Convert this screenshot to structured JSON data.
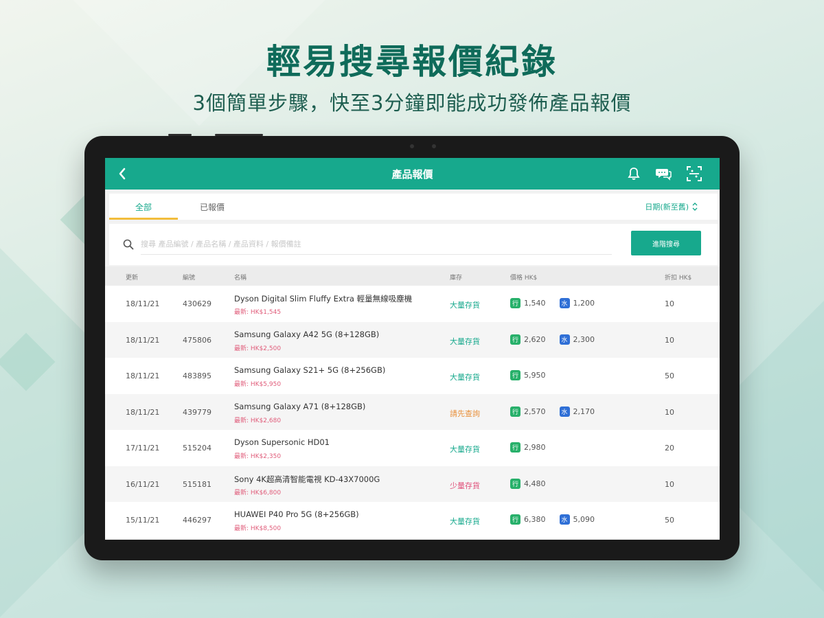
{
  "promo": {
    "title": "輕易搜尋報價紀錄",
    "subtitle": "3個簡單步驟，快至3分鐘即能成功發佈產品報價"
  },
  "app": {
    "title": "產品報價",
    "icons": [
      "back-chevron-icon",
      "bell-icon",
      "chat-icon",
      "scan-icon"
    ],
    "accent_color": "#17a98d"
  },
  "tabs": {
    "all": "全部",
    "quoted": "已報價",
    "sort_label": "日期(新至舊)"
  },
  "search": {
    "placeholder": "搜尋 產品編號 / 產品名稱 / 產品資料 / 報價備註",
    "advanced_button": "進階搜尋"
  },
  "table": {
    "headers": {
      "updated": "更新",
      "code": "編號",
      "name": "名稱",
      "stock": "庫存",
      "price": "價格 HK$",
      "discount": "折扣 HK$"
    },
    "rows": [
      {
        "date": "18/11/21",
        "code": "430629",
        "name": "Dyson Digital Slim Fluffy Extra 輕量無線吸塵機",
        "ref": "最新: HK$1,545",
        "stock": "大量存貨",
        "stock_color": "green",
        "price_a": "1,540",
        "price_b": "1,200",
        "discount": "10"
      },
      {
        "date": "18/11/21",
        "code": "475806",
        "name": "Samsung Galaxy A42 5G (8+128GB)",
        "ref": "最新: HK$2,500",
        "stock": "大量存貨",
        "stock_color": "green",
        "price_a": "2,620",
        "price_b": "2,300",
        "discount": "10"
      },
      {
        "date": "18/11/21",
        "code": "483895",
        "name": "Samsung Galaxy S21+ 5G (8+256GB)",
        "ref": "最新: HK$5,950",
        "stock": "大量存貨",
        "stock_color": "green",
        "price_a": "5,950",
        "price_b": "",
        "discount": "50"
      },
      {
        "date": "18/11/21",
        "code": "439779",
        "name": "Samsung Galaxy A71 (8+128GB)",
        "ref": "最新: HK$2,680",
        "stock": "請先查詢",
        "stock_color": "orange",
        "price_a": "2,570",
        "price_b": "2,170",
        "discount": "10"
      },
      {
        "date": "17/11/21",
        "code": "515204",
        "name": "Dyson Supersonic HD01",
        "ref": "最新: HK$2,350",
        "stock": "大量存貨",
        "stock_color": "green",
        "price_a": "2,980",
        "price_b": "",
        "discount": "20"
      },
      {
        "date": "16/11/21",
        "code": "515181",
        "name": "Sony 4K超高清智能電視 KD-43X7000G",
        "ref": "最新: HK$6,800",
        "stock": "少量存貨",
        "stock_color": "red",
        "price_a": "4,480",
        "price_b": "",
        "discount": "10"
      },
      {
        "date": "15/11/21",
        "code": "446297",
        "name": "HUAWEI P40 Pro 5G (8+256GB)",
        "ref": "最新: HK$8,500",
        "stock": "大量存貨",
        "stock_color": "green",
        "price_a": "6,380",
        "price_b": "5,090",
        "discount": "50"
      }
    ],
    "badge_a": "行",
    "badge_b": "水"
  }
}
